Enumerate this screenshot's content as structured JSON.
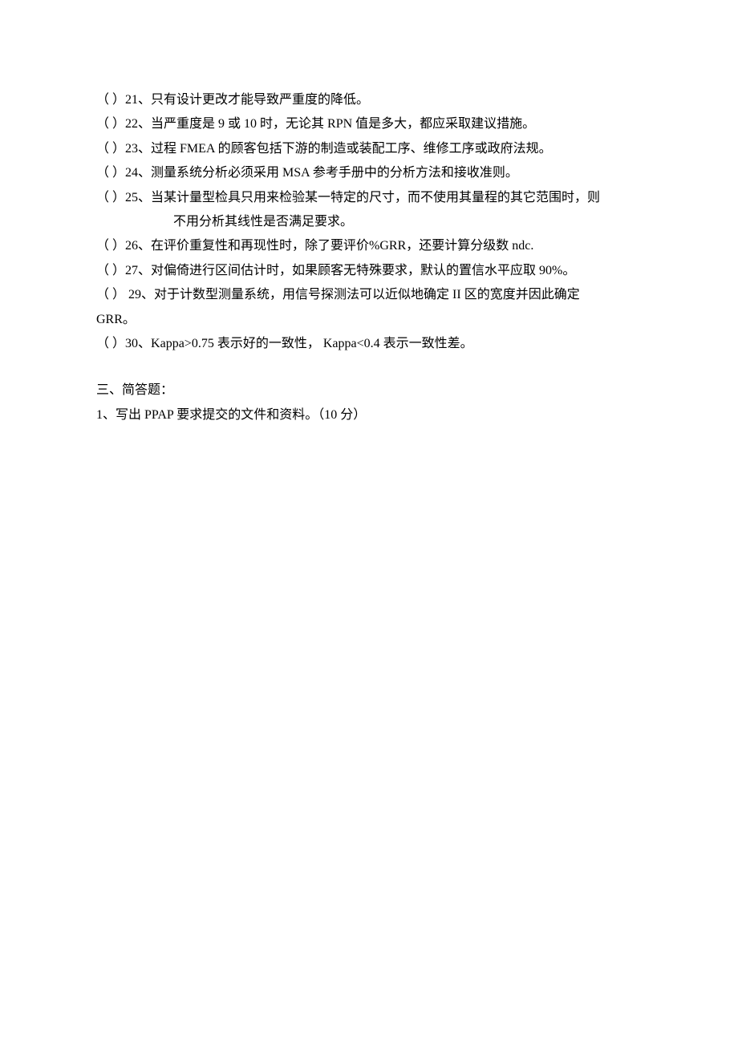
{
  "questions": {
    "q21": {
      "prefix": "（",
      "blank": "     ",
      "suffix": "）21、",
      "text": "只有设计更改才能导致严重度的降低。"
    },
    "q22": {
      "prefix": "（",
      "blank": "     ",
      "suffix": "）22、",
      "text": "当严重度是 9 或 10 时，无论其 RPN 值是多大，都应采取建议措施。"
    },
    "q23": {
      "prefix": "（",
      "blank": "     ",
      "suffix": "）23、",
      "text": "过程 FMEA 的顾客包括下游的制造或装配工序、维修工序或政府法规。"
    },
    "q24": {
      "prefix": "（",
      "blank": "     ",
      "suffix": "）24、",
      "text": "测量系统分析必须采用 MSA 参考手册中的分析方法和接收准则。"
    },
    "q25": {
      "prefix": "（",
      "blank": "     ",
      "suffix": "）25、",
      "text_line1": "当某计量型检具只用来检验某一特定的尺寸，而不使用其量程的其它范围时，则",
      "text_line2": "不用分析其线性是否满足要求。"
    },
    "q26": {
      "prefix": "（",
      "blank": "     ",
      "suffix": "）26、",
      "text": "在评价重复性和再现性时，除了要评价%GRR，还要计算分级数 ndc."
    },
    "q27": {
      "prefix": "（",
      "blank": "     ",
      "suffix": "）27、",
      "text": "对偏倚进行区间估计时，如果顾客无特殊要求，默认的置信水平应取 90%。"
    },
    "q29": {
      "prefix": "（",
      "blank": "       ",
      "suffix": "） 29、",
      "text_line1": "对于计数型测量系统，用信号探测法可以近似地确定 II 区的宽度并因此确定",
      "text_line2": "GRR。"
    },
    "q30": {
      "prefix": "（",
      "blank": "     ",
      "suffix": "）30、",
      "text": "Kappa>0.75 表示好的一致性，  Kappa<0.4 表示一致性差。"
    }
  },
  "section3": {
    "heading": "三、简答题：",
    "q1": "1、写出 PPAP 要求提交的文件和资料。（10 分）"
  }
}
